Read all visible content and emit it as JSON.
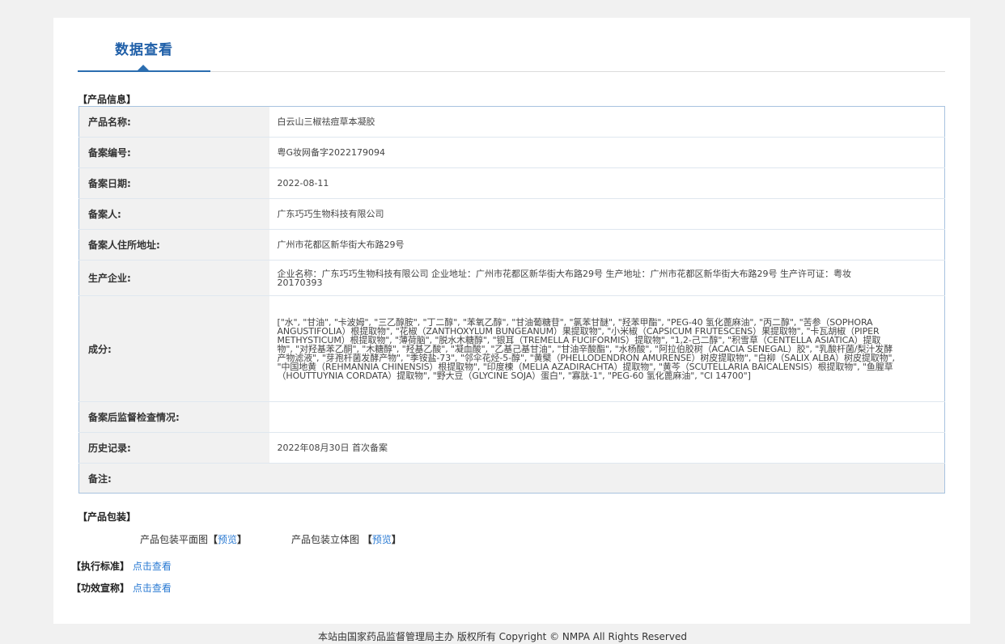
{
  "tab": {
    "label": "数据查看"
  },
  "product_info": {
    "section_title": "【产品信息】",
    "rows": [
      {
        "label": "产品名称:",
        "value": "白云山三椒祛痘草本凝胶"
      },
      {
        "label": "备案编号:",
        "value": "粤G妆网备字2022179094"
      },
      {
        "label": "备案日期:",
        "value": "2022-08-11"
      },
      {
        "label": "备案人:",
        "value": "广东巧巧生物科技有限公司"
      },
      {
        "label": "备案人住所地址:",
        "value": "广州市花都区新华街大布路29号"
      },
      {
        "label": "生产企业:",
        "value": "企业名称：广东巧巧生物科技有限公司 企业地址：广州市花都区新华街大布路29号 生产地址：广州市花都区新华街大布路29号 生产许可证：粤妆20170393"
      },
      {
        "label": "成分:",
        "value": "[\"水\", \"甘油\", \"卡波姆\", \"三乙醇胺\", \"丁二醇\", \"苯氧乙醇\", \"甘油葡糖苷\", \"氯苯甘醚\", \"羟苯甲酯\", \"PEG-40 氢化蓖麻油\", \"丙二醇\", \"苦参（SOPHORA ANGUSTIFOLIA）根提取物\", \"花椒（ZANTHOXYLUM BUNGEANUM）果提取物\", \"小米椒（CAPSICUM FRUTESCENS）果提取物\", \"卡瓦胡椒（PIPER METHYSTICUM）根提取物\", \"薄荷脑\", \"脱水木糖醇\", \"银耳（TREMELLA FUCIFORMIS）提取物\", \"1,2-己二醇\", \"积雪草（CENTELLA ASIATICA）提取物\", \"对羟基苯乙酮\", \"木糖醇\", \"羟基乙酸\", \"凝血酸\", \"乙基己基甘油\", \"甘油辛酸酯\", \"水杨酸\", \"阿拉伯胶树（ACACIA SENEGAL）胶\", \"乳酸杆菌/梨汁发酵产物滤液\", \"芽孢杆菌发酵产物\", \"季铵盐-73\", \"邻伞花烃-5-醇\", \"黄檗（PHELLODENDRON AMURENSE）树皮提取物\", \"白柳（SALIX ALBA）树皮提取物\", \"中国地黄（REHMANNIA CHINENSIS）根提取物\", \"印度楝（MELIA AZADIRACHTA）提取物\", \"黄芩（SCUTELLARIA BAICALENSIS）根提取物\", \"鱼腥草（HOUTTUYNIA CORDATA）提取物\", \"野大豆（GLYCINE SOJA）蛋白\", \"寡肽-1\", \"PEG-60 氢化蓖麻油\", \"CI 14700\"]"
      },
      {
        "label": "备案后监督检查情况:",
        "value": ""
      },
      {
        "label": "历史记录:",
        "value": "2022年08月30日 首次备案"
      },
      {
        "label": "备注:",
        "value": ""
      }
    ]
  },
  "packaging": {
    "section_title": "【产品包装】",
    "flat_label": "产品包装平面图",
    "solid_label": "产品包装立体图",
    "bracket_open": "【",
    "bracket_close": "】",
    "preview_label": "预览"
  },
  "standard": {
    "label": "【执行标准】",
    "link": "点击查看"
  },
  "efficacy": {
    "label": "【功效宣称】",
    "link": "点击查看"
  },
  "footer": {
    "text": "本站由国家药品监督管理局主办 版权所有 Copyright © NMPA All Rights Reserved"
  }
}
